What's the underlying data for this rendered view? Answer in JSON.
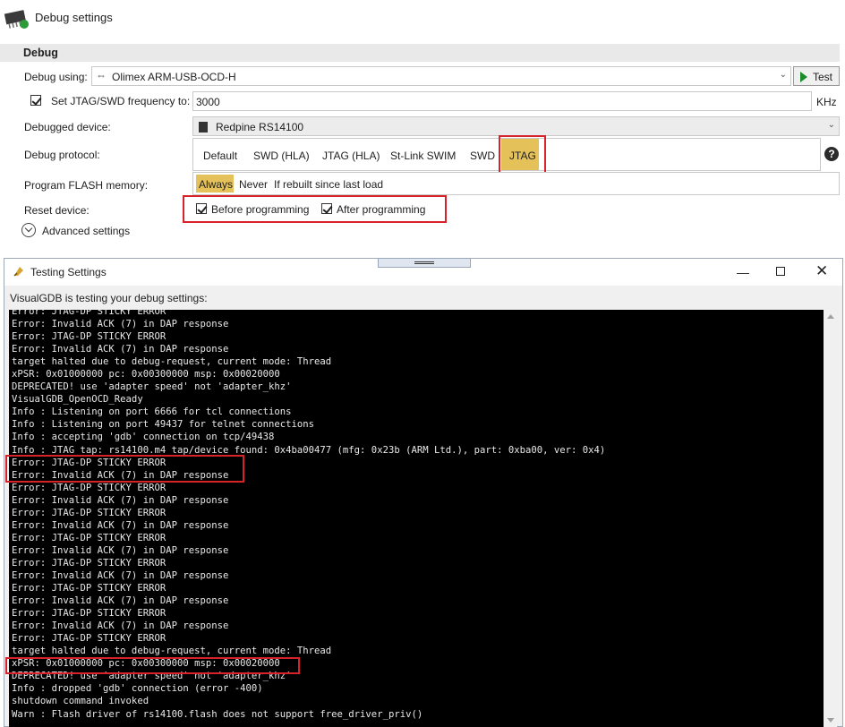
{
  "header": {
    "title": "Debug settings",
    "icon": "chip-icon"
  },
  "section": {
    "title": "Debug"
  },
  "debug_using": {
    "label": "Debug using:",
    "value": "Olimex ARM-USB-OCD-H",
    "icon": "usb-icon",
    "test_label": "Test"
  },
  "jtag_freq": {
    "label": "Set JTAG/SWD frequency to:",
    "checked": true,
    "value": "3000",
    "unit": "KHz"
  },
  "device": {
    "label": "Debugged device:",
    "value": "Redpine RS14100",
    "icon": "chip-icon"
  },
  "protocol": {
    "label": "Debug protocol:",
    "options": [
      "Default",
      "SWD (HLA)",
      "JTAG (HLA)",
      "St-Link SWIM",
      "SWD",
      "JTAG"
    ],
    "selected": "JTAG"
  },
  "flash": {
    "label": "Program FLASH memory:",
    "options": [
      "Always",
      "Never",
      "If rebuilt since last load"
    ],
    "selected": "Always"
  },
  "reset": {
    "label": "Reset device:",
    "before": "Before programming",
    "after": "After programming"
  },
  "advanced": {
    "label": "Advanced settings"
  },
  "colors": {
    "highlight": "#e5c15a",
    "annotation_red": "#d6222b",
    "console_bg": "#000000"
  },
  "testing_window": {
    "title": "Testing Settings",
    "intro": "VisualGDB is testing your debug settings:",
    "console_lines": [
      "Error: JTAG-DP STICKY ERROR",
      "Error: Invalid ACK (7) in DAP response",
      "Error: JTAG-DP STICKY ERROR",
      "Error: Invalid ACK (7) in DAP response",
      "target halted due to debug-request, current mode: Thread",
      "xPSR: 0x01000000 pc: 0x00300000 msp: 0x00020000",
      "DEPRECATED! use 'adapter speed' not 'adapter_khz'",
      "VisualGDB_OpenOCD_Ready",
      "Info : Listening on port 6666 for tcl connections",
      "Info : Listening on port 49437 for telnet connections",
      "Info : accepting 'gdb' connection on tcp/49438",
      "Info : JTAG tap: rs14100.m4 tap/device found: 0x4ba00477 (mfg: 0x23b (ARM Ltd.), part: 0xba00, ver: 0x4)",
      "Error: JTAG-DP STICKY ERROR",
      "Error: Invalid ACK (7) in DAP response",
      "Error: JTAG-DP STICKY ERROR",
      "Error: Invalid ACK (7) in DAP response",
      "Error: JTAG-DP STICKY ERROR",
      "Error: Invalid ACK (7) in DAP response",
      "Error: JTAG-DP STICKY ERROR",
      "Error: Invalid ACK (7) in DAP response",
      "Error: JTAG-DP STICKY ERROR",
      "Error: Invalid ACK (7) in DAP response",
      "Error: JTAG-DP STICKY ERROR",
      "Error: Invalid ACK (7) in DAP response",
      "Error: JTAG-DP STICKY ERROR",
      "Error: Invalid ACK (7) in DAP response",
      "Error: JTAG-DP STICKY ERROR",
      "target halted due to debug-request, current mode: Thread",
      "xPSR: 0x01000000 pc: 0x00300000 msp: 0x00020000",
      "DEPRECATED! use 'adapter speed' not 'adapter_khz'",
      "Info : dropped 'gdb' connection (error -400)",
      "shutdown command invoked",
      "Warn : Flash driver of rs14100.flash does not support free_driver_priv()"
    ]
  }
}
